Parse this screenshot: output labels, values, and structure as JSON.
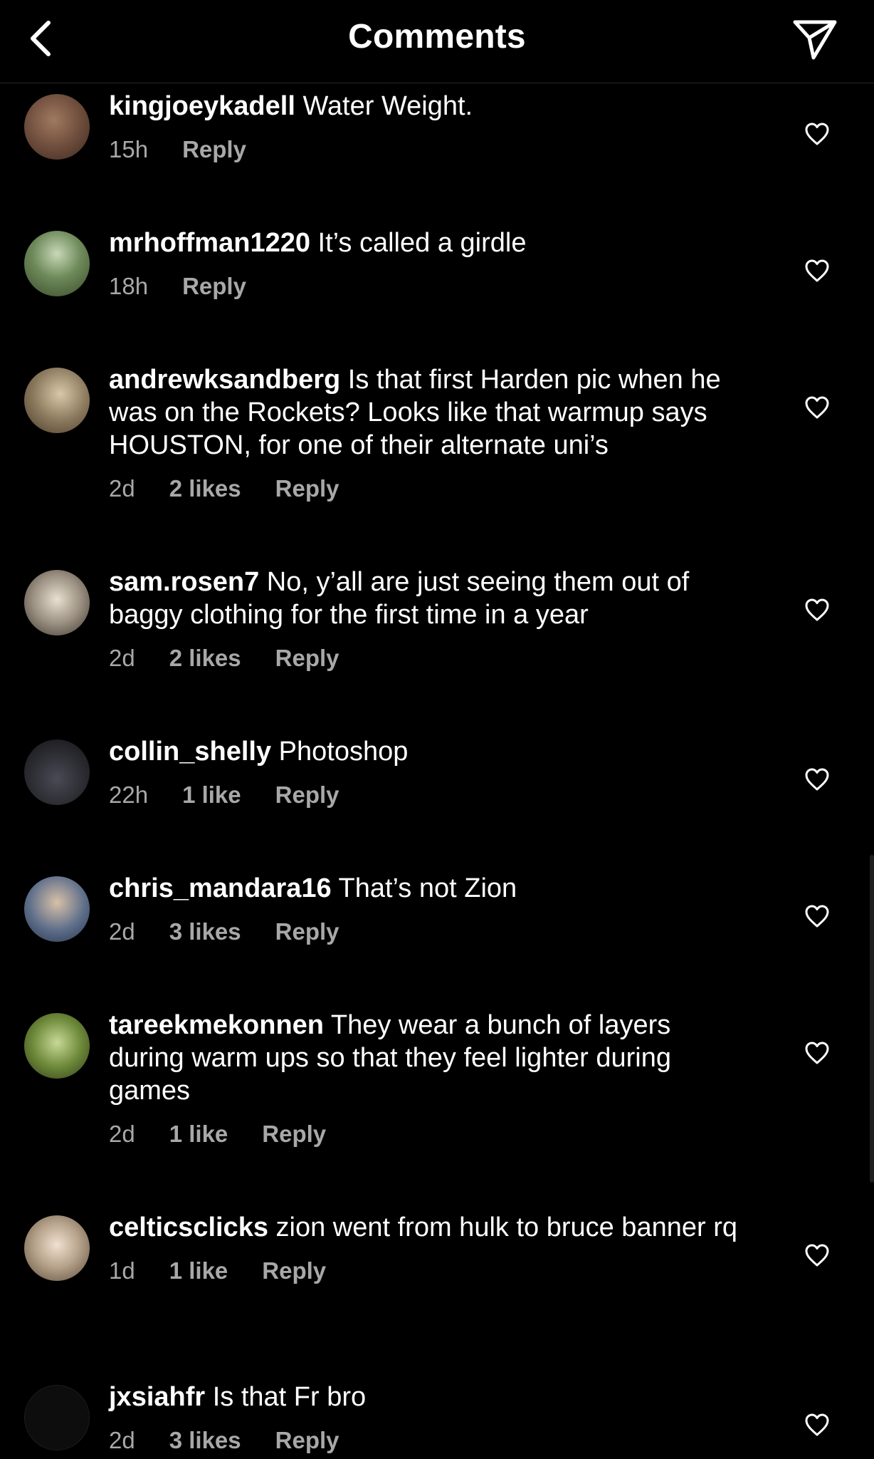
{
  "header": {
    "title": "Comments",
    "back_icon": "chevron-left-icon",
    "share_icon": "paper-plane-icon"
  },
  "comments": [
    {
      "username": "kingjoeykadell",
      "text": "Water Weight.",
      "time": "15h",
      "likes": "",
      "reply": "Reply",
      "avatar_color": "#6b4a3a"
    },
    {
      "username": "mrhoffman1220",
      "text": "It’s called a girdle",
      "time": "18h",
      "likes": "",
      "reply": "Reply",
      "avatar_color": "#4e6b3c"
    },
    {
      "username": "andrewksandberg",
      "text": "Is that first Harden pic when he was on the Rockets? Looks like that warmup says HOUSTON, for one of their alternate uni’s",
      "time": "2d",
      "likes": "2 likes",
      "reply": "Reply",
      "avatar_color": "#8c7a5e"
    },
    {
      "username": "sam.rosen7",
      "text": "No, y’all are just seeing them out of baggy clothing for the first time in a year",
      "time": "2d",
      "likes": "2 likes",
      "reply": "Reply",
      "avatar_color": "#9a8f80"
    },
    {
      "username": "collin_shelly",
      "text": "Photoshop",
      "time": "22h",
      "likes": "1 like",
      "reply": "Reply",
      "avatar_color": "#2a2a30"
    },
    {
      "username": "chris_mandara16",
      "text": "That’s not Zion",
      "time": "2d",
      "likes": "3 likes",
      "reply": "Reply",
      "avatar_color": "#5d6e8a"
    },
    {
      "username": "tareekmekonnen",
      "text": "They wear a bunch of layers during warm ups so that they feel lighter during games",
      "time": "2d",
      "likes": "1 like",
      "reply": "Reply",
      "avatar_color": "#6e8a3a"
    },
    {
      "username": "celticsclicks",
      "text": "zion went from hulk to bruce banner rq",
      "time": "1d",
      "likes": "1 like",
      "reply": "Reply",
      "avatar_color": "#b8a48c"
    },
    {
      "username": "jxsiahfr",
      "text": "Is that Fr bro",
      "time": "2d",
      "likes": "3 likes",
      "reply": "Reply",
      "avatar_color": "#0d0d0d"
    }
  ],
  "colors": {
    "background": "#000000",
    "text": "#ffffff",
    "secondary": "#a8a8a8",
    "divider": "#262626"
  },
  "icons": {
    "like": "heart-outline-icon"
  }
}
